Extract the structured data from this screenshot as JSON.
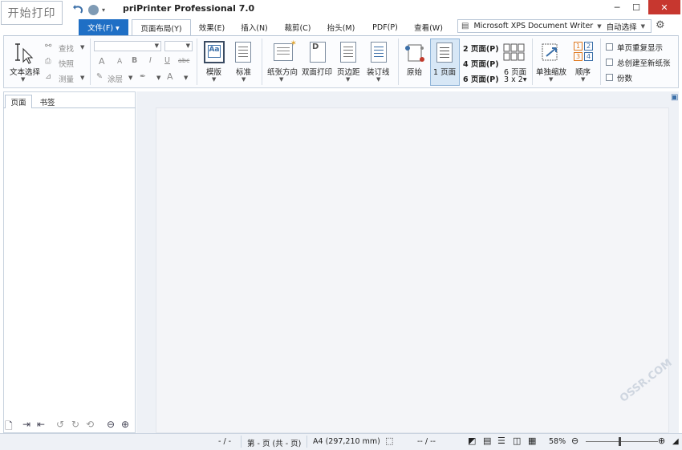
{
  "app": {
    "start_print": "开始打印",
    "title": "priPrinter Professional 7.0"
  },
  "window": {
    "minimize": "─",
    "maximize": "☐",
    "close": "✕"
  },
  "tabs": {
    "file": "文件(F) ▾",
    "items": [
      "页面布局(Y)",
      "效果(E)",
      "插入(N)",
      "裁剪(C)",
      "抬头(M)",
      "PDF(P)",
      "查看(W)"
    ]
  },
  "printer": {
    "name": "Microsoft XPS Document Writer",
    "select": "自动选择"
  },
  "ribbon": {
    "text_select": "文本选择",
    "find": "查找",
    "snapshot": "快照",
    "measure": "测量",
    "font_controls": [
      "A",
      "A",
      "B",
      "I",
      "U",
      "abc"
    ],
    "brush": "涂层",
    "pen": "笔",
    "template": "模版",
    "mark": "标准",
    "orientation": "纸张方向",
    "duplex": "双面打印",
    "margins": "页边距",
    "binding": "装订线",
    "original": "原始",
    "one_page": "1 页面",
    "two_page": "2 页面(P)",
    "four_page": "4 页面(P)",
    "six_page": "6 页面(P)",
    "six_page_grid": "6 页面",
    "six_grid_sub": "3 x 2▾",
    "single_zoom": "单独缩放",
    "order": "顺序",
    "check_repeat": "单页重复显示",
    "check_new_sheet": "总创建至新纸张",
    "check_copies": "份数",
    "order_nums": [
      "1",
      "2",
      "3",
      "4"
    ]
  },
  "left_pane": {
    "tab_pages": "页面",
    "tab_bookmarks": "书签"
  },
  "status": {
    "page_nav": "- / -",
    "page_info": "第 - 页 (共 - 页)",
    "paper": "A4 (297,210 mm)",
    "coords": "-- / --",
    "zoom": "58%"
  },
  "watermark": "OSSR.COM",
  "colors": {
    "accent": "#1f6fc5",
    "close": "#c7372f",
    "selected": "#d7e7f6"
  }
}
